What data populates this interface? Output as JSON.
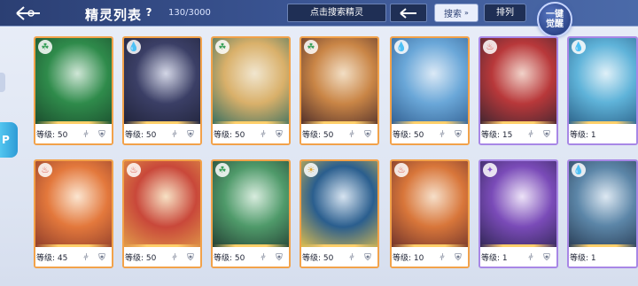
{
  "header": {
    "title": "精灵列表",
    "help": "?",
    "count": "130/3000",
    "search_placeholder": "点击搜索精灵",
    "filter_label": "搜索",
    "sort_label": "排列",
    "awaken_line1": "一键",
    "awaken_line2": "觉醒"
  },
  "side_tab": {
    "label": "P"
  },
  "rows": [
    [
      {
        "level": "等级: 50",
        "border": "orange",
        "attr": "grass",
        "art": [
          "#2f8b4b",
          "#1a4a2c",
          "#cfe6d6"
        ]
      },
      {
        "level": "等级: 50",
        "border": "orange",
        "attr": "water",
        "art": [
          "#3b3f66",
          "#1f2238",
          "#d3d6e6"
        ]
      },
      {
        "level": "等级: 50",
        "border": "orange",
        "attr": "grass",
        "art": [
          "#d9b06a",
          "#2f6b5f",
          "#f1e6cf"
        ]
      },
      {
        "level": "等级: 50",
        "border": "orange",
        "attr": "grass",
        "art": [
          "#c98546",
          "#4a2a28",
          "#f2dec4"
        ]
      },
      {
        "level": "等级: 50",
        "border": "orange",
        "attr": "water",
        "art": [
          "#6aa7d8",
          "#2f5c8e",
          "#dbe9f6"
        ]
      },
      {
        "level": "等级: 15",
        "border": "purple",
        "attr": "fire",
        "art": [
          "#b8383a",
          "#3a2530",
          "#f1d2c9"
        ]
      },
      {
        "level": "等级: 1",
        "border": "purple",
        "attr": "water",
        "art": [
          "#5fb3d9",
          "#2a5f86",
          "#dff0f8"
        ]
      }
    ],
    [
      {
        "level": "等级: 45",
        "border": "orange",
        "attr": "fire",
        "art": [
          "#e3783c",
          "#8a3a2a",
          "#fbe5d0"
        ]
      },
      {
        "level": "等级: 50",
        "border": "orange",
        "attr": "fire",
        "art": [
          "#c9483a",
          "#e2a14a",
          "#f7e1c4"
        ]
      },
      {
        "level": "等级: 50",
        "border": "orange",
        "attr": "grass",
        "art": [
          "#4f9a6a",
          "#213a30",
          "#d8ecde"
        ]
      },
      {
        "level": "等级: 50",
        "border": "orange",
        "attr": "light",
        "art": [
          "#2a5e8e",
          "#e6c24a",
          "#d6e3f0"
        ]
      },
      {
        "level": "等级: 10",
        "border": "orange",
        "attr": "fire",
        "art": [
          "#d8763a",
          "#6a2f2a",
          "#f6dfc9"
        ]
      },
      {
        "level": "等级: 1",
        "border": "purple",
        "attr": "dark",
        "art": [
          "#7a4bb8",
          "#2d2550",
          "#ece2f7"
        ]
      },
      {
        "level": "等级: 1",
        "border": "purple",
        "attr": "water",
        "art": [
          "#5c86a8",
          "#273a52",
          "#dde8f2"
        ]
      }
    ]
  ],
  "colors": {
    "orange_border": "#f2a24a",
    "purple_border": "#a887e6",
    "header_bg": "#2b3f73"
  }
}
